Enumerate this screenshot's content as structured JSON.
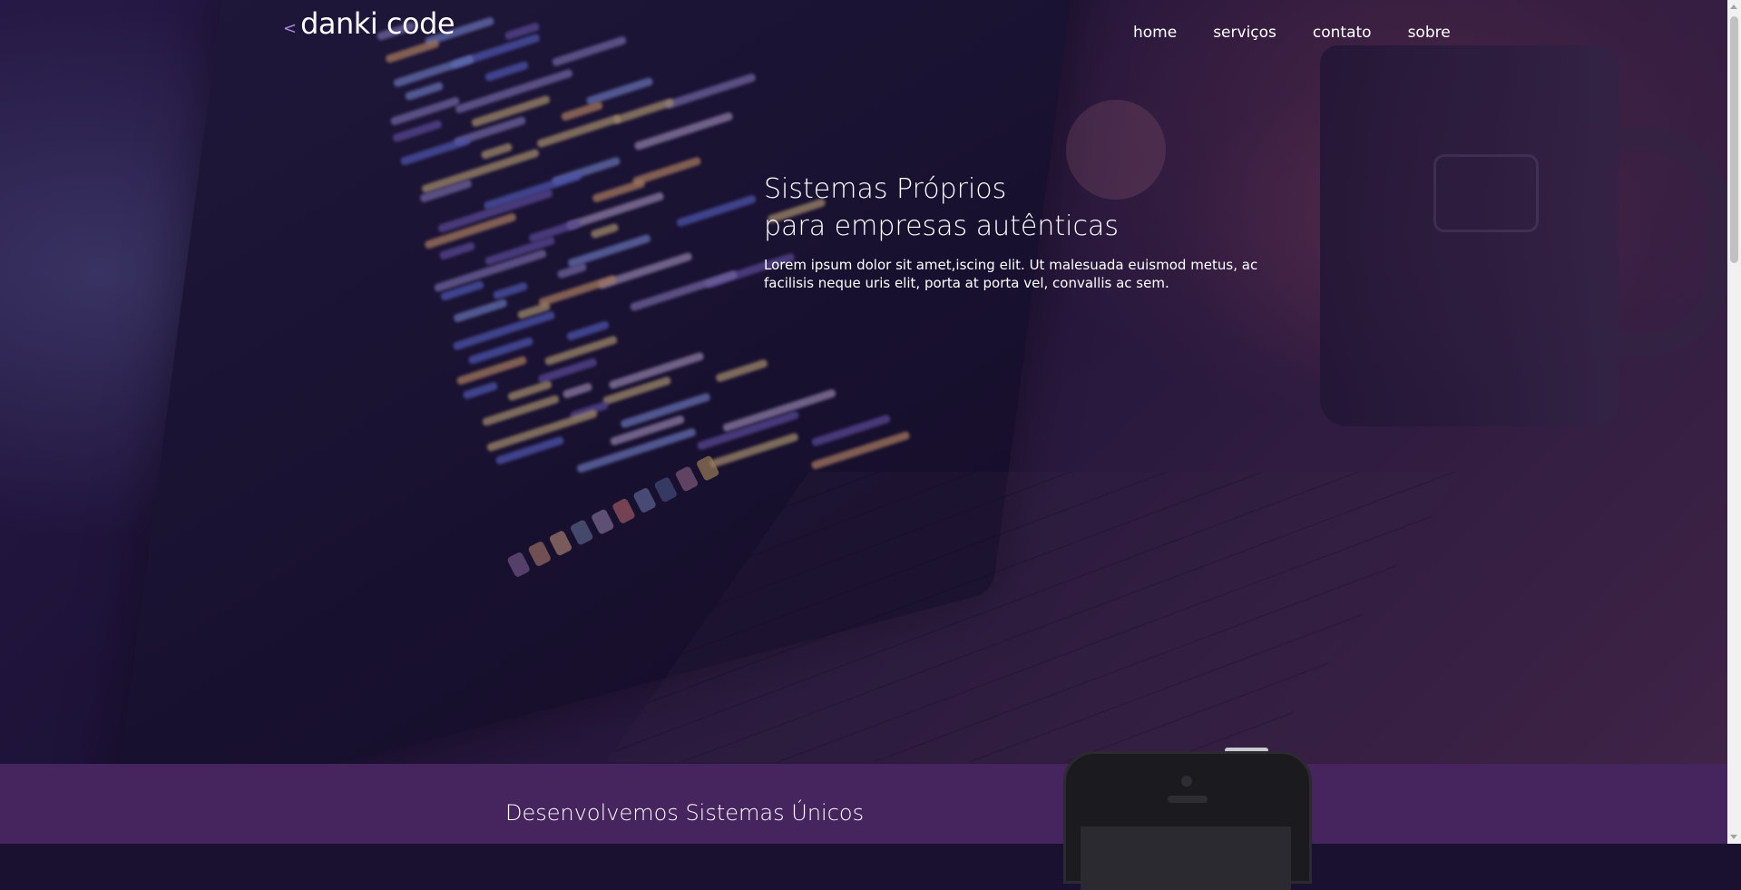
{
  "header": {
    "logo_arrow": "<",
    "logo_text": "danki code",
    "nav": [
      {
        "label": "home"
      },
      {
        "label": "serviços"
      },
      {
        "label": "contato"
      },
      {
        "label": "sobre"
      }
    ]
  },
  "hero": {
    "title_line1": "Sistemas Próprios",
    "title_line2": "para empresas autênticas",
    "text": "Lorem ipsum dolor sit amet,iscing elit. Ut malesuada euismod metus, ac facilisis neque uris elit, porta at porta vel, convallis ac sem."
  },
  "section2": {
    "title": "Desenvolvemos Sistemas Únicos"
  },
  "colors": {
    "section_bg": "#46245e",
    "logo_accent": "#a58bd8"
  }
}
